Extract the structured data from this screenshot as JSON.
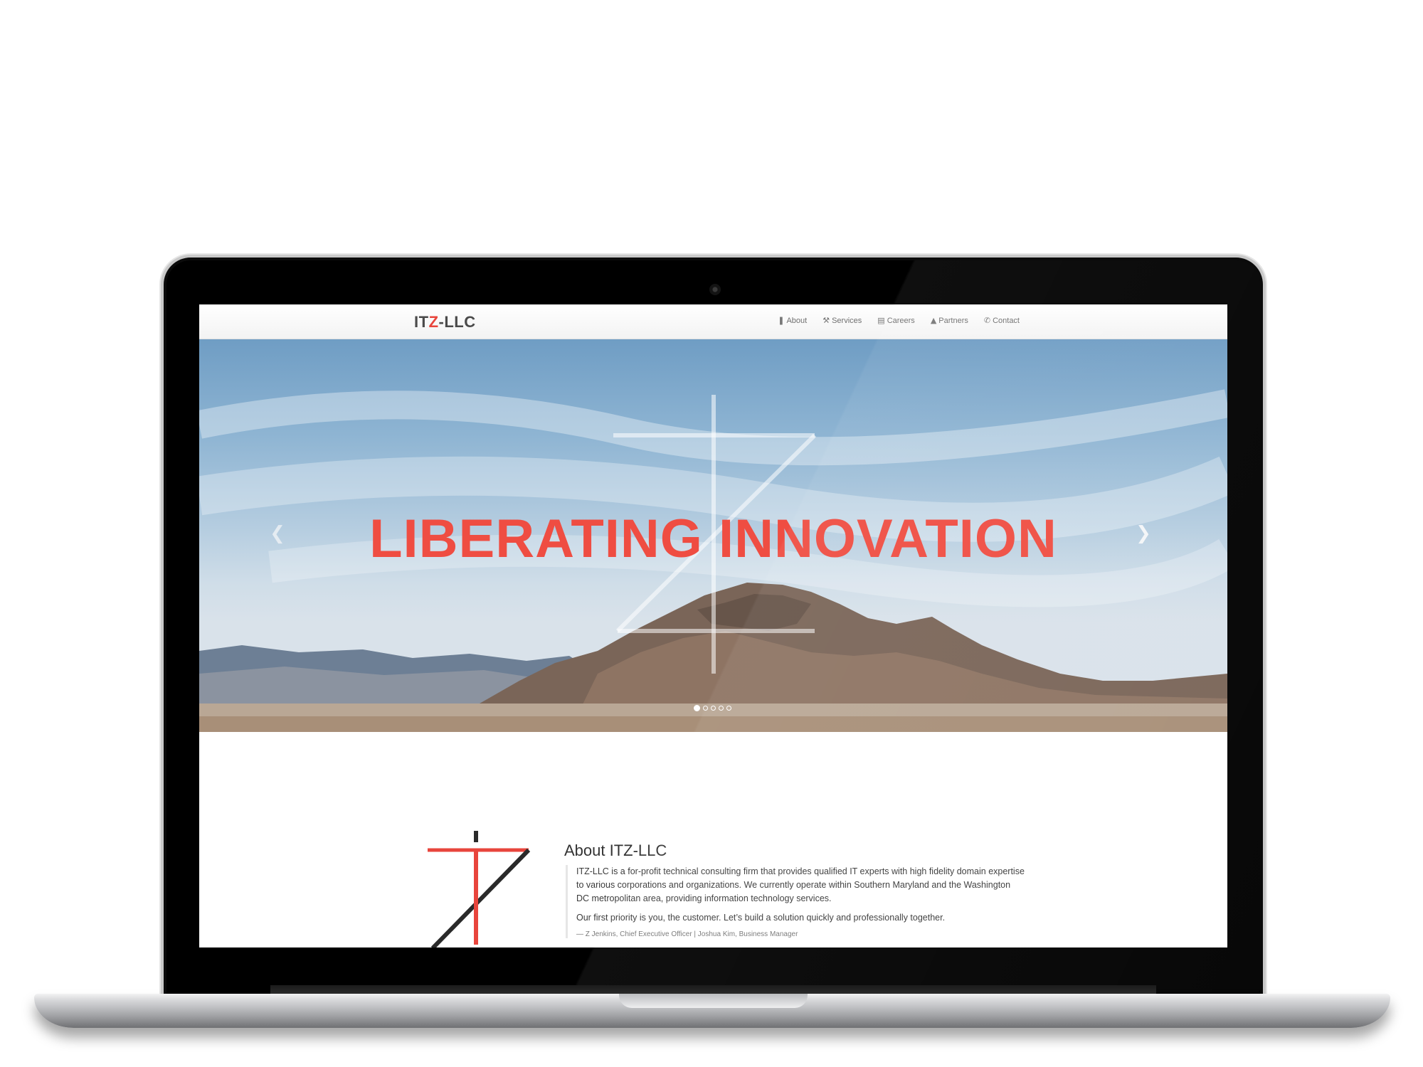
{
  "brand": {
    "prefix": "IT",
    "accent": "Z",
    "suffix": "-LLC",
    "accent_color": "#e8453c"
  },
  "nav": {
    "items": [
      {
        "label": "About",
        "icon": "bookmark-icon"
      },
      {
        "label": "Services",
        "icon": "wrench-icon"
      },
      {
        "label": "Careers",
        "icon": "briefcase-icon"
      },
      {
        "label": "Partners",
        "icon": "user-icon"
      },
      {
        "label": "Contact",
        "icon": "phone-icon"
      }
    ]
  },
  "hero": {
    "title": "LIBERATING INNOVATION",
    "title_color": "#ef4d42",
    "slides_total": 5,
    "active_slide": 1
  },
  "about": {
    "title": "About ITZ-LLC",
    "paragraph_1": "ITZ-LLC is a for-profit technical consulting firm that provides qualified IT experts with high fidelity domain expertise to various corporations and organizations. We currently operate within Southern Maryland and the Washington DC metropolitan area, providing information technology services.",
    "paragraph_2": "Our first priority is you, the customer. Let’s build a solution quickly and professionally together.",
    "footer": "— Z Jenkins, Chief Executive Officer | Joshua Kim, Business Manager"
  }
}
